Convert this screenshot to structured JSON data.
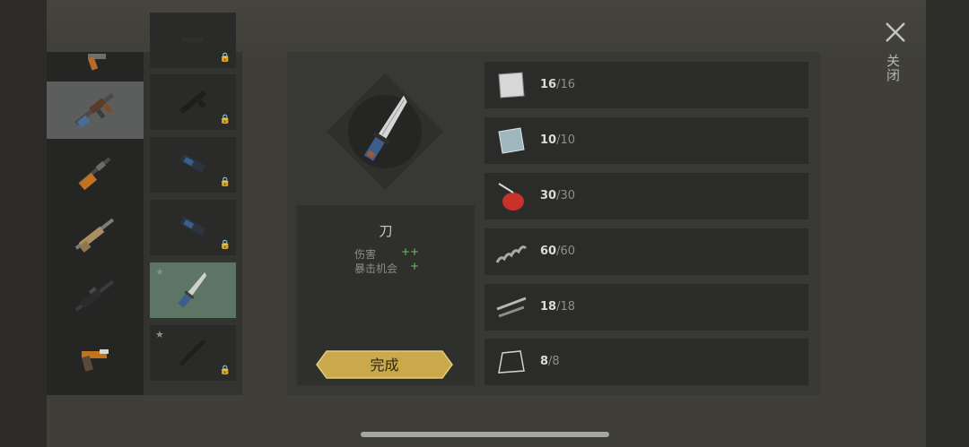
{
  "close": {
    "label": "关闭",
    "icon": "close-icon"
  },
  "weapons": [
    {
      "icon": "pistol-icon"
    },
    {
      "icon": "assault-rifle-icon",
      "selected": true
    },
    {
      "icon": "smg-icon"
    },
    {
      "icon": "tan-rifle-icon"
    },
    {
      "icon": "m16-rifle-icon"
    },
    {
      "icon": "flare-pistol-icon"
    }
  ],
  "attachments": [
    {
      "icon": "scope-icon",
      "locked": true
    },
    {
      "icon": "grip-icon",
      "locked": true
    },
    {
      "icon": "stock-icon",
      "locked": true
    },
    {
      "icon": "stock-icon",
      "locked": true
    },
    {
      "icon": "knife-icon",
      "starred": true,
      "active": true
    },
    {
      "icon": "bayonet-icon",
      "starred": true,
      "locked": true
    }
  ],
  "item": {
    "name": "刀",
    "stats": [
      {
        "label": "伤害",
        "value": "++"
      },
      {
        "label": "暴击机会",
        "value": "+"
      }
    ],
    "action_label": "完成"
  },
  "materials": [
    {
      "icon": "metal-sheet-icon",
      "have": "16",
      "total": "/16"
    },
    {
      "icon": "glass-plate-icon",
      "have": "10",
      "total": "/10"
    },
    {
      "icon": "oil-can-icon",
      "have": "30",
      "total": "/30"
    },
    {
      "icon": "spring-icon",
      "have": "60",
      "total": "/60"
    },
    {
      "icon": "pipe-parts-icon",
      "have": "18",
      "total": "/18"
    },
    {
      "icon": "bent-metal-icon",
      "have": "8",
      "total": "/8"
    }
  ],
  "colors": {
    "accent_gold": "#c9a94a",
    "stat_green": "#6bbf6b",
    "active_slot": "#5c7564"
  }
}
